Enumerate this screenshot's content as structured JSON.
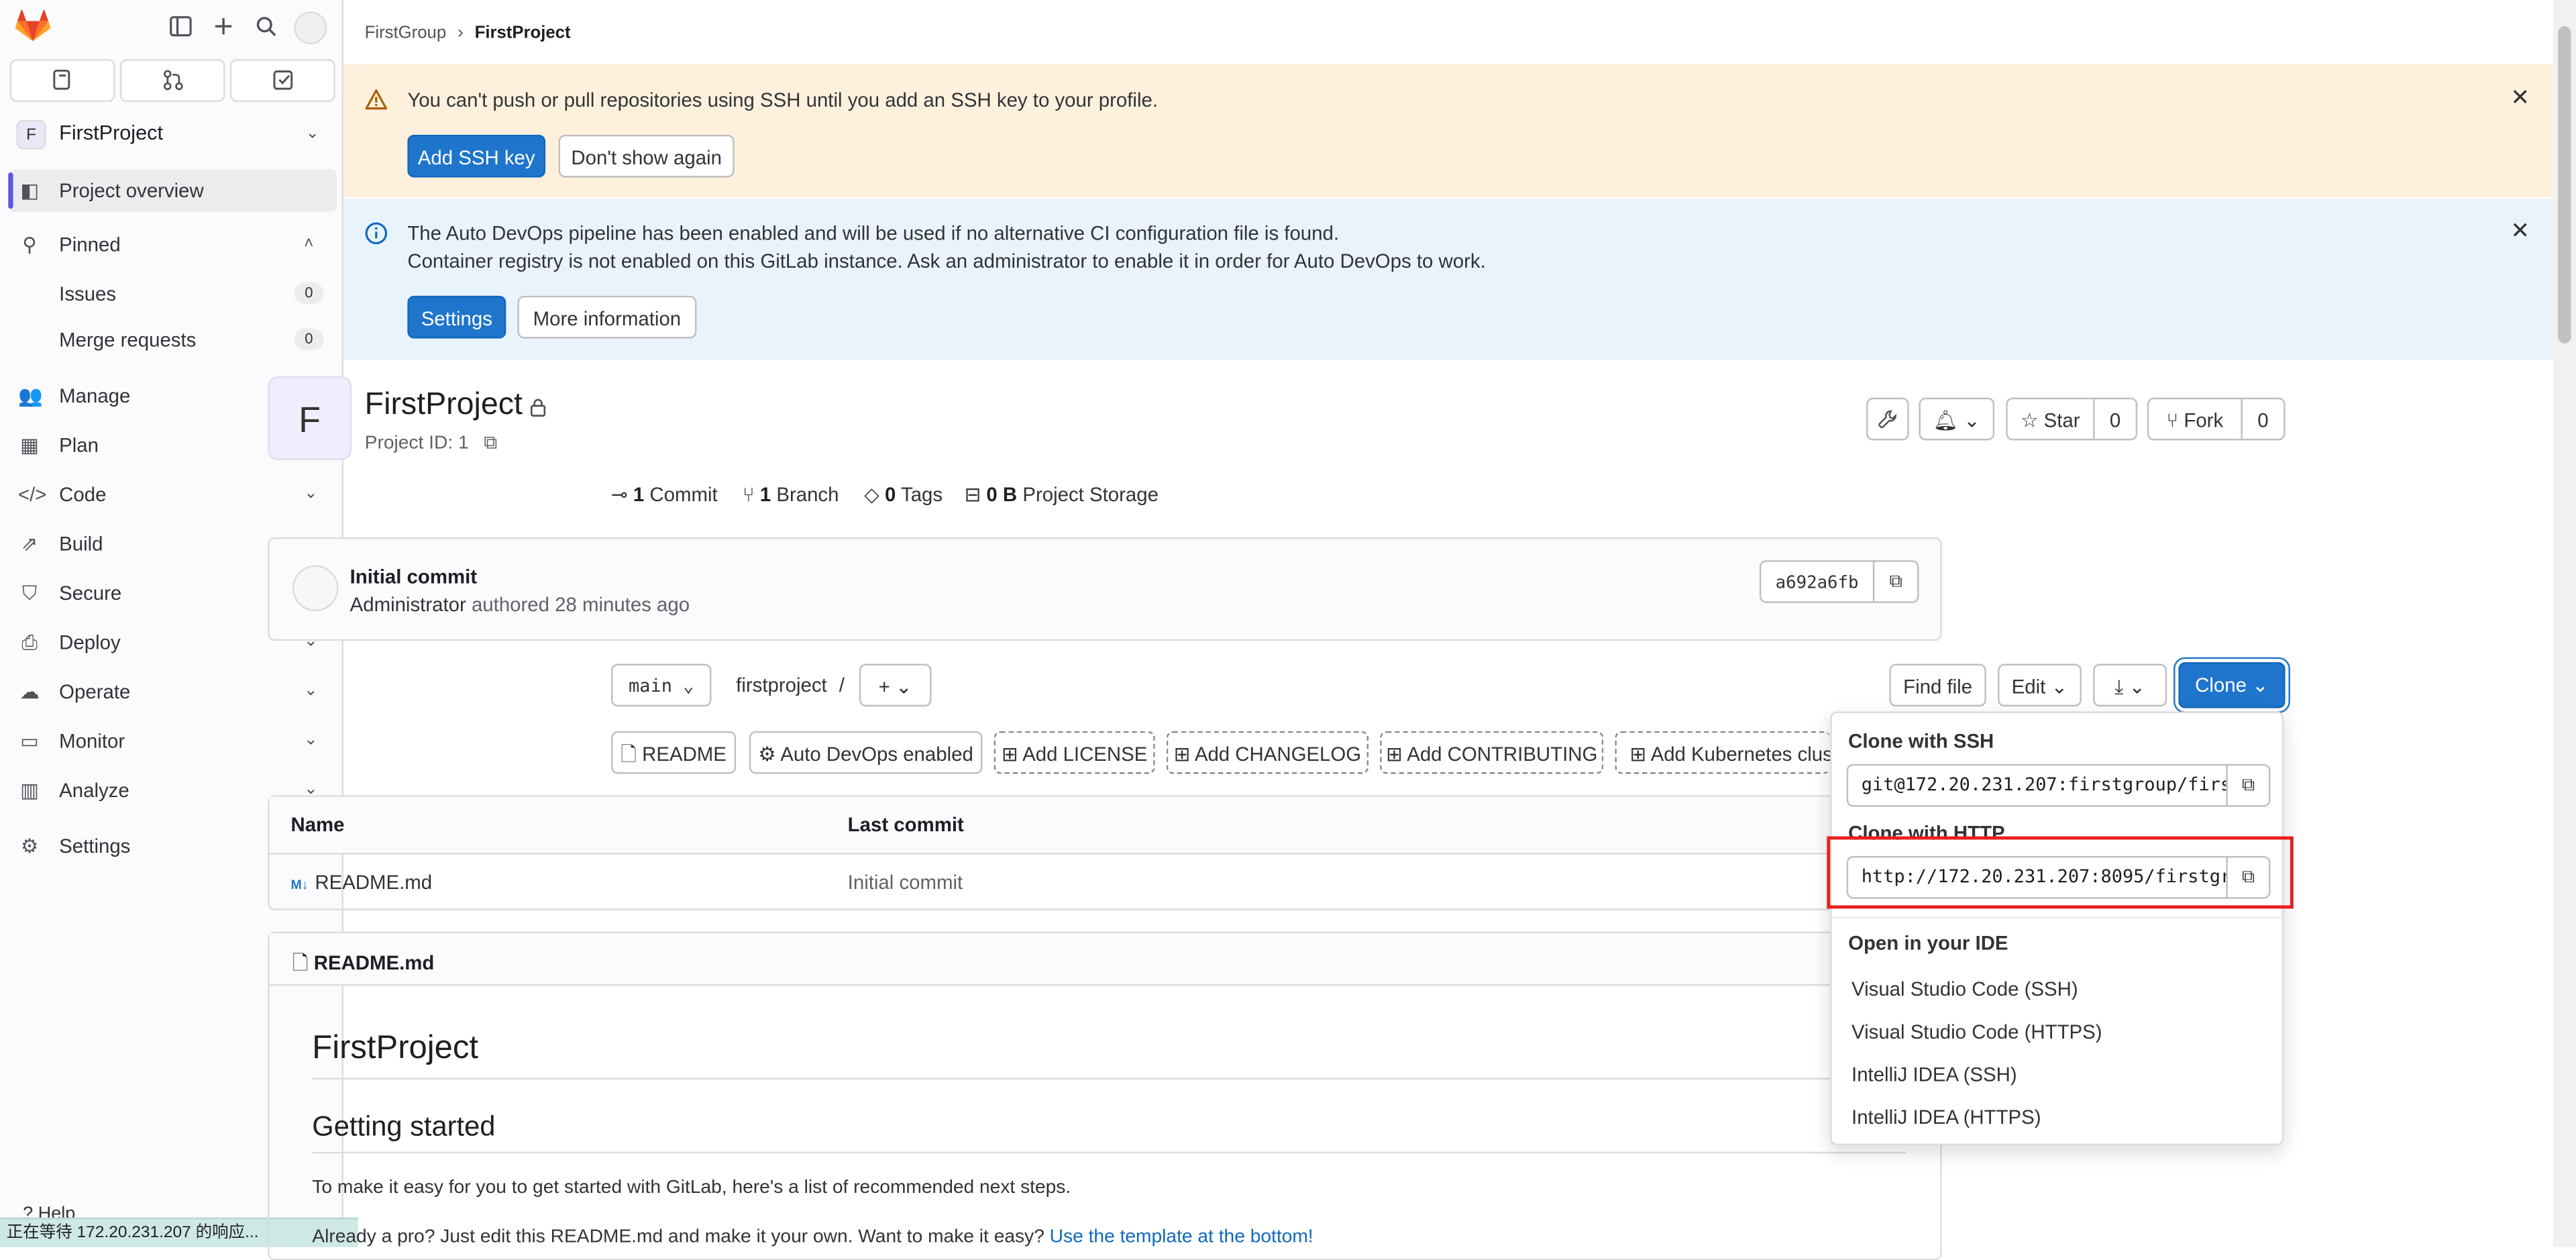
{
  "sidebar": {
    "project_initial": "F",
    "project_name": "FirstProject",
    "items": [
      {
        "label": "Project overview",
        "icon": "project-icon"
      },
      {
        "label": "Pinned",
        "icon": "pin-icon"
      },
      {
        "label": "Issues",
        "count": "0"
      },
      {
        "label": "Merge requests",
        "count": "0"
      },
      {
        "label": "Manage",
        "icon": "users-icon"
      },
      {
        "label": "Plan",
        "icon": "planning-icon"
      },
      {
        "label": "Code",
        "icon": "code-icon"
      },
      {
        "label": "Build",
        "icon": "rocket-icon"
      },
      {
        "label": "Secure",
        "icon": "shield-icon"
      },
      {
        "label": "Deploy",
        "icon": "deploy-icon"
      },
      {
        "label": "Operate",
        "icon": "cloud-icon"
      },
      {
        "label": "Monitor",
        "icon": "monitor-icon"
      },
      {
        "label": "Analyze",
        "icon": "chart-icon"
      },
      {
        "label": "Settings",
        "icon": "settings-icon"
      }
    ],
    "help": "Help"
  },
  "status_bar": "正在等待 172.20.231.207 的响应...",
  "breadcrumb": {
    "group": "FirstGroup",
    "separator": "›",
    "project": "FirstProject"
  },
  "alerts": {
    "ssh": {
      "text": "You can't push or pull repositories using SSH until you add an SSH key to your profile.",
      "primary": "Add SSH key",
      "secondary": "Don't show again"
    },
    "devops": {
      "line1": "The Auto DevOps pipeline has been enabled and will be used if no alternative CI configuration file is found.",
      "line2": "Container registry is not enabled on this GitLab instance. Ask an administrator to enable it in order for Auto DevOps to work.",
      "primary": "Settings",
      "secondary": "More information"
    }
  },
  "project": {
    "initial": "F",
    "title": "FirstProject",
    "id_label": "Project ID: 1",
    "star_label": "Star",
    "star_count": "0",
    "fork_label": "Fork",
    "fork_count": "0",
    "stats": {
      "commits_n": "1",
      "commits_l": "Commit",
      "branches_n": "1",
      "branches_l": "Branch",
      "tags_n": "0",
      "tags_l": "Tags",
      "storage_n": "0 B",
      "storage_l": "Project Storage"
    }
  },
  "commit": {
    "title": "Initial commit",
    "author": "Administrator",
    "meta": "authored 28 minutes ago",
    "sha": "a692a6fb"
  },
  "repo_bar": {
    "branch": "main",
    "path": "firstproject",
    "path_sep": "/",
    "find_file": "Find file",
    "edit": "Edit",
    "clone": "Clone"
  },
  "shortcuts": [
    "README",
    "Auto DevOps enabled",
    "Add LICENSE",
    "Add CHANGELOG",
    "Add CONTRIBUTING",
    "Add Kubernetes clust"
  ],
  "files": {
    "headers": [
      "Name",
      "Last commit"
    ],
    "rows": [
      {
        "name": "README.md",
        "last_commit": "Initial commit"
      }
    ]
  },
  "readme": {
    "header": "README.md",
    "h1": "FirstProject",
    "h2": "Getting started",
    "p1": "To make it easy for you to get started with GitLab, here's a list of recommended next steps.",
    "p2": "Already a pro? Just edit this README.md and make it your own. Want to make it easy? ",
    "p2_link": "Use the template at the bottom!"
  },
  "clone_dropdown": {
    "ssh_heading": "Clone with SSH",
    "ssh_url": "git@172.20.231.207:firstgroup/firs",
    "http_heading": "Clone with HTTP",
    "http_url": "http://172.20.231.207:8095/firstgr",
    "ide_heading": "Open in your IDE",
    "ide_items": [
      "Visual Studio Code (SSH)",
      "Visual Studio Code (HTTPS)",
      "IntelliJ IDEA (SSH)",
      "IntelliJ IDEA (HTTPS)"
    ]
  },
  "colors": {
    "primary": "#1f75cb",
    "warning_bg": "#fdf1dd",
    "info_bg": "#e9f3fc",
    "highlight": "#e8201f"
  }
}
